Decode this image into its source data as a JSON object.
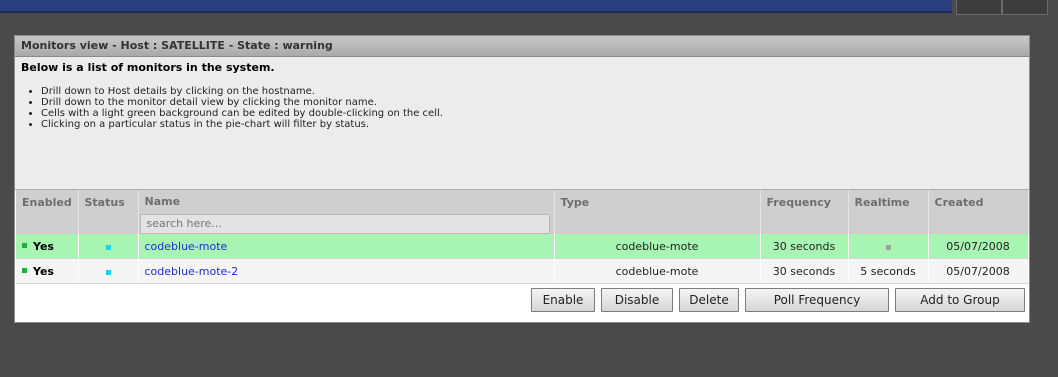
{
  "panel": {
    "title": "Monitors view - Host : SATELLITE - State : warning"
  },
  "info": {
    "heading": "Below is a list of monitors in the system.",
    "bullets": [
      "Drill down to Host details by clicking on the hostname.",
      "Drill down to the monitor detail view by clicking the monitor name.",
      "Cells with a light green background can be edited by double-clicking on the cell.",
      "Clicking on a particular status in the pie-chart will filter by status."
    ]
  },
  "table": {
    "columns": [
      "Enabled",
      "Status",
      "Name",
      "Type",
      "Frequency",
      "Realtime",
      "Created"
    ],
    "search_placeholder": "search here...",
    "rows": [
      {
        "enabled": "Yes",
        "status": "",
        "name": "codeblue-mote",
        "type": "codeblue-mote",
        "frequency": "30 seconds",
        "realtime": "",
        "created": "05/07/2008"
      },
      {
        "enabled": "Yes",
        "status": "",
        "name": "codeblue-mote-2",
        "type": "codeblue-mote",
        "frequency": "30 seconds",
        "realtime": "5 seconds",
        "created": "05/07/2008"
      }
    ]
  },
  "buttons": {
    "enable": "Enable",
    "disable": "Disable",
    "delete": "Delete",
    "poll_frequency": "Poll Frequency",
    "add_to_group": "Add to Group"
  },
  "colors": {
    "top_bar": "#2b3f7e",
    "editable_row": "#a8f5b3",
    "status_indicator": "#19d4f0",
    "enabled_indicator": "#19b33a",
    "link": "#1c2fd0"
  },
  "icons": {
    "enabled_indicator": "green-square-icon",
    "status_indicator": "cyan-square-icon",
    "realtime_indicator": "gray-square-icon"
  }
}
